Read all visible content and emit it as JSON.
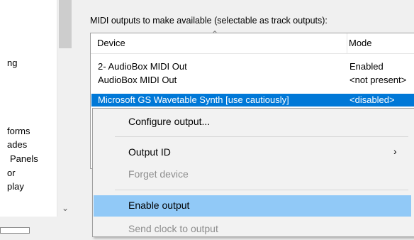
{
  "left_list": {
    "items": [
      "ng",
      "forms",
      "ades",
      "Panels",
      "or",
      "play"
    ]
  },
  "outputs_group": {
    "label": "MIDI outputs to make available (selectable as track outputs):"
  },
  "list": {
    "columns": [
      "Device",
      "Mode"
    ],
    "rows": [
      {
        "device": "2- AudioBox MIDI Out",
        "mode": "Enabled"
      },
      {
        "device": "AudioBox MIDI Out",
        "mode": "<not present>"
      },
      {
        "device": "Microsoft GS Wavetable Synth [use cautiously]",
        "mode": "<disabled>"
      }
    ]
  },
  "context_menu": {
    "items": [
      {
        "label": "Configure output...",
        "enabled": true
      },
      {
        "label": "Output ID",
        "enabled": true,
        "submenu": true
      },
      {
        "label": "Forget device",
        "enabled": false
      },
      {
        "label": "Enable output",
        "enabled": true,
        "highlighted": true
      },
      {
        "label": "Send clock to output",
        "enabled": false
      }
    ]
  },
  "icons": {
    "sort": "chevron-up-icon",
    "submenu": "chevron-right-icon",
    "scroll_down": "chevron-down-icon"
  },
  "colors": {
    "selection": "#0078d7",
    "menu_highlight": "#91c9f7",
    "disabled_text": "#8d8d8d"
  }
}
